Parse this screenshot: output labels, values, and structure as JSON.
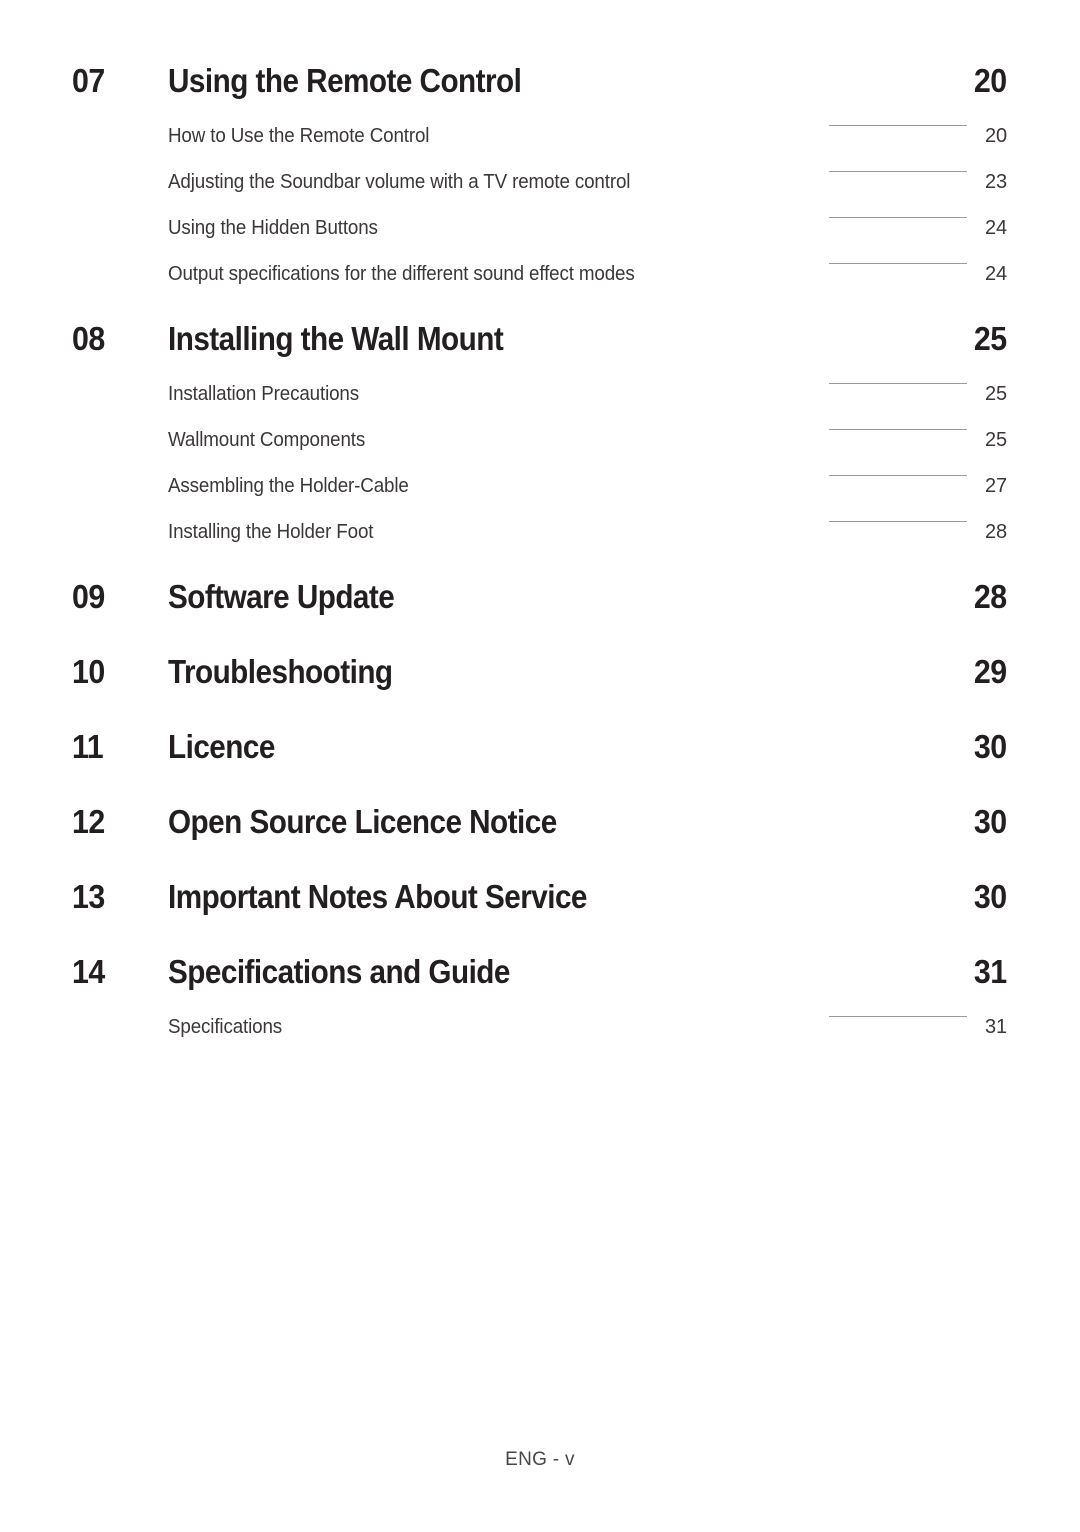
{
  "page": {
    "footer": "ENG - v"
  },
  "toc": {
    "sections": [
      {
        "number": "07",
        "title": "Using the Remote Control",
        "page": "20",
        "entries": [
          {
            "title": "How to Use the Remote Control",
            "page": "20"
          },
          {
            "title": "Adjusting the Soundbar volume with a TV remote control",
            "page": "23"
          },
          {
            "title": "Using the Hidden Buttons",
            "page": "24"
          },
          {
            "title": "Output specifications for the different sound effect modes",
            "page": "24"
          }
        ]
      },
      {
        "number": "08",
        "title": "Installing the Wall Mount",
        "page": "25",
        "entries": [
          {
            "title": "Installation Precautions",
            "page": "25"
          },
          {
            "title": "Wallmount Components",
            "page": "25"
          },
          {
            "title": "Assembling the Holder-Cable",
            "page": "27"
          },
          {
            "title": "Installing the Holder Foot",
            "page": "28"
          }
        ]
      },
      {
        "number": "09",
        "title": "Software Update",
        "page": "28",
        "entries": []
      },
      {
        "number": "10",
        "title": "Troubleshooting",
        "page": "29",
        "entries": []
      },
      {
        "number": "11",
        "title": "Licence",
        "page": "30",
        "entries": []
      },
      {
        "number": "12",
        "title": "Open Source Licence Notice",
        "page": "30",
        "entries": []
      },
      {
        "number": "13",
        "title": "Important Notes About Service",
        "page": "30",
        "entries": []
      },
      {
        "number": "14",
        "title": "Specifications and Guide",
        "page": "31",
        "entries": [
          {
            "title": "Specifications",
            "page": "31"
          }
        ]
      }
    ]
  }
}
